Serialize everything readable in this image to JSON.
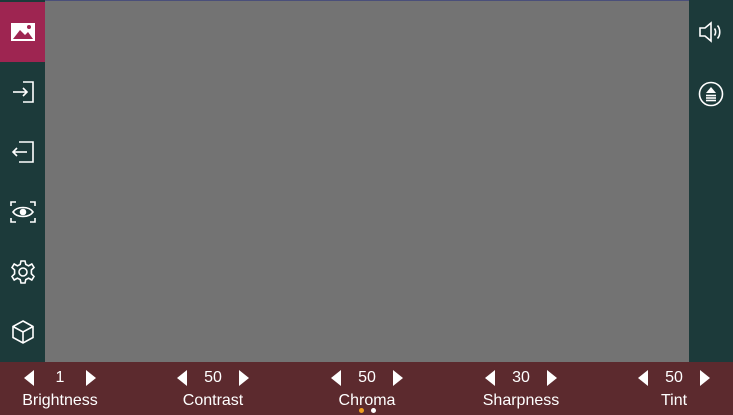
{
  "left_nav": {
    "items": [
      {
        "icon": "image-icon",
        "active": true
      },
      {
        "icon": "input-icon",
        "active": false
      },
      {
        "icon": "output-icon",
        "active": false
      },
      {
        "icon": "view-scan-icon",
        "active": false
      },
      {
        "icon": "settings-gear-icon",
        "active": false
      },
      {
        "icon": "3d-cube-icon",
        "active": false
      }
    ]
  },
  "right_nav": {
    "items": [
      {
        "icon": "speaker-volume-icon"
      },
      {
        "icon": "upload-circle-icon"
      }
    ]
  },
  "controls": [
    {
      "label": "Brightness",
      "value": "1"
    },
    {
      "label": "Contrast",
      "value": "50"
    },
    {
      "label": "Chroma",
      "value": "50"
    },
    {
      "label": "Sharpness",
      "value": "30"
    },
    {
      "label": "Tint",
      "value": "50"
    }
  ],
  "pager": {
    "pages": 2,
    "current": 1
  },
  "colors": {
    "sidebar": "#1c3a3a",
    "active_nav": "#9e2551",
    "viewport": "#737373",
    "bottom_bar": "#5c2a2e",
    "page_dot_active": "#f0a020",
    "page_dot_inactive": "#ffffff"
  }
}
